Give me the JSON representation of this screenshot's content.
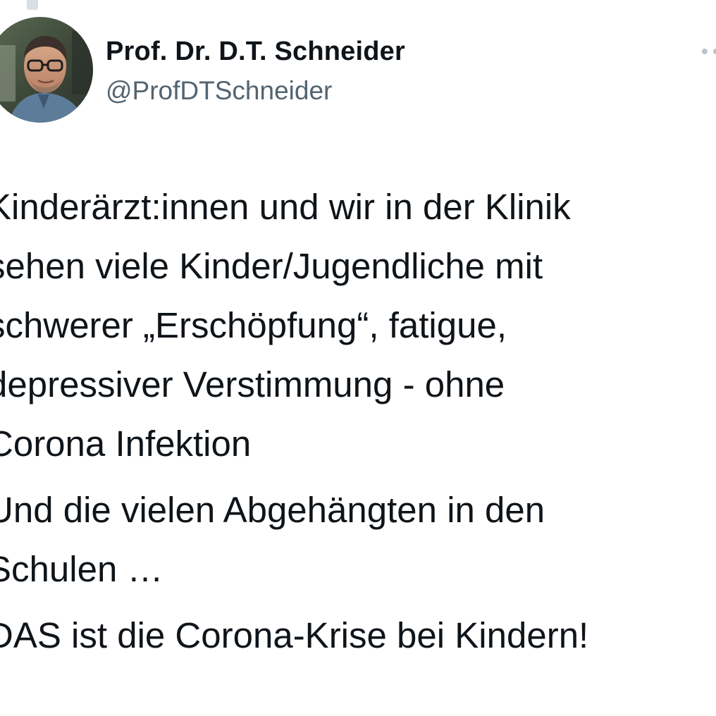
{
  "tweet": {
    "author": {
      "display_name": "Prof. Dr. D.T. Schneider",
      "handle": "@ProfDTSchneider",
      "avatar_icon": "profile-photo"
    },
    "more_icon": "more-dots-icon",
    "paragraphs": [
      {
        "lines": [
          "Kinderärzt:innen und wir in der Klinik",
          "sehen viele Kinder/Jugendliche mit",
          "schwerer „Erschöpfung“, fatigue,",
          "depressiver Verstimmung - ohne",
          "Corona Infektion"
        ]
      },
      {
        "lines": [
          "Und die vielen Abgehängten in den",
          "Schulen …"
        ]
      },
      {
        "lines": [
          "DAS ist die Corona-Krise bei Kindern!"
        ]
      }
    ]
  },
  "colors": {
    "text_primary": "#0f1419",
    "text_secondary": "#536471",
    "background": "#ffffff"
  }
}
